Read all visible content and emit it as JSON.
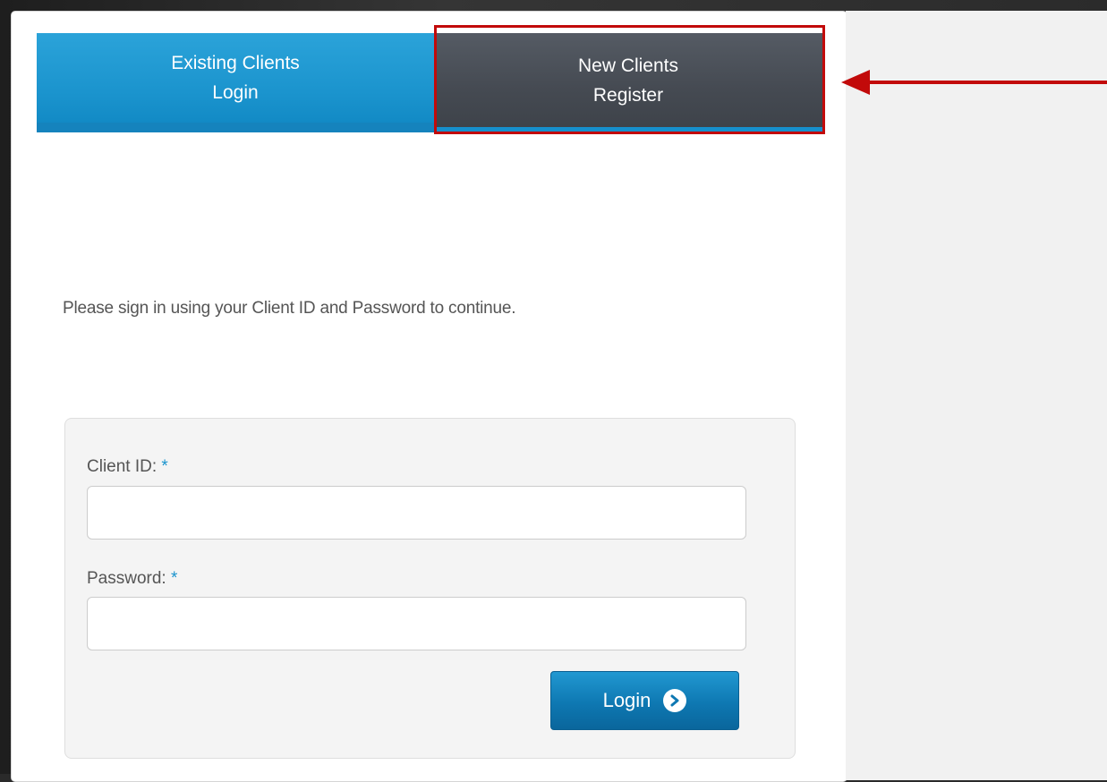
{
  "tabs": {
    "login": {
      "line1": "Existing Clients",
      "line2": "Login"
    },
    "register": {
      "line1": "New Clients",
      "line2": "Register"
    }
  },
  "intro": "Please sign in using your Client ID and Password to continue.",
  "form": {
    "client_id_label": "Client ID:",
    "password_label": "Password:",
    "required_mark": "*",
    "client_id_value": "",
    "password_value": "",
    "login_button": "Login",
    "login_icon": "chevron-right-circle-icon"
  },
  "annotation": {
    "highlight_color": "#c20a0a",
    "arrow_icon": "left-arrow-icon"
  },
  "colors": {
    "accent_blue": "#1a93cd",
    "tab_dark": "#454a52"
  }
}
